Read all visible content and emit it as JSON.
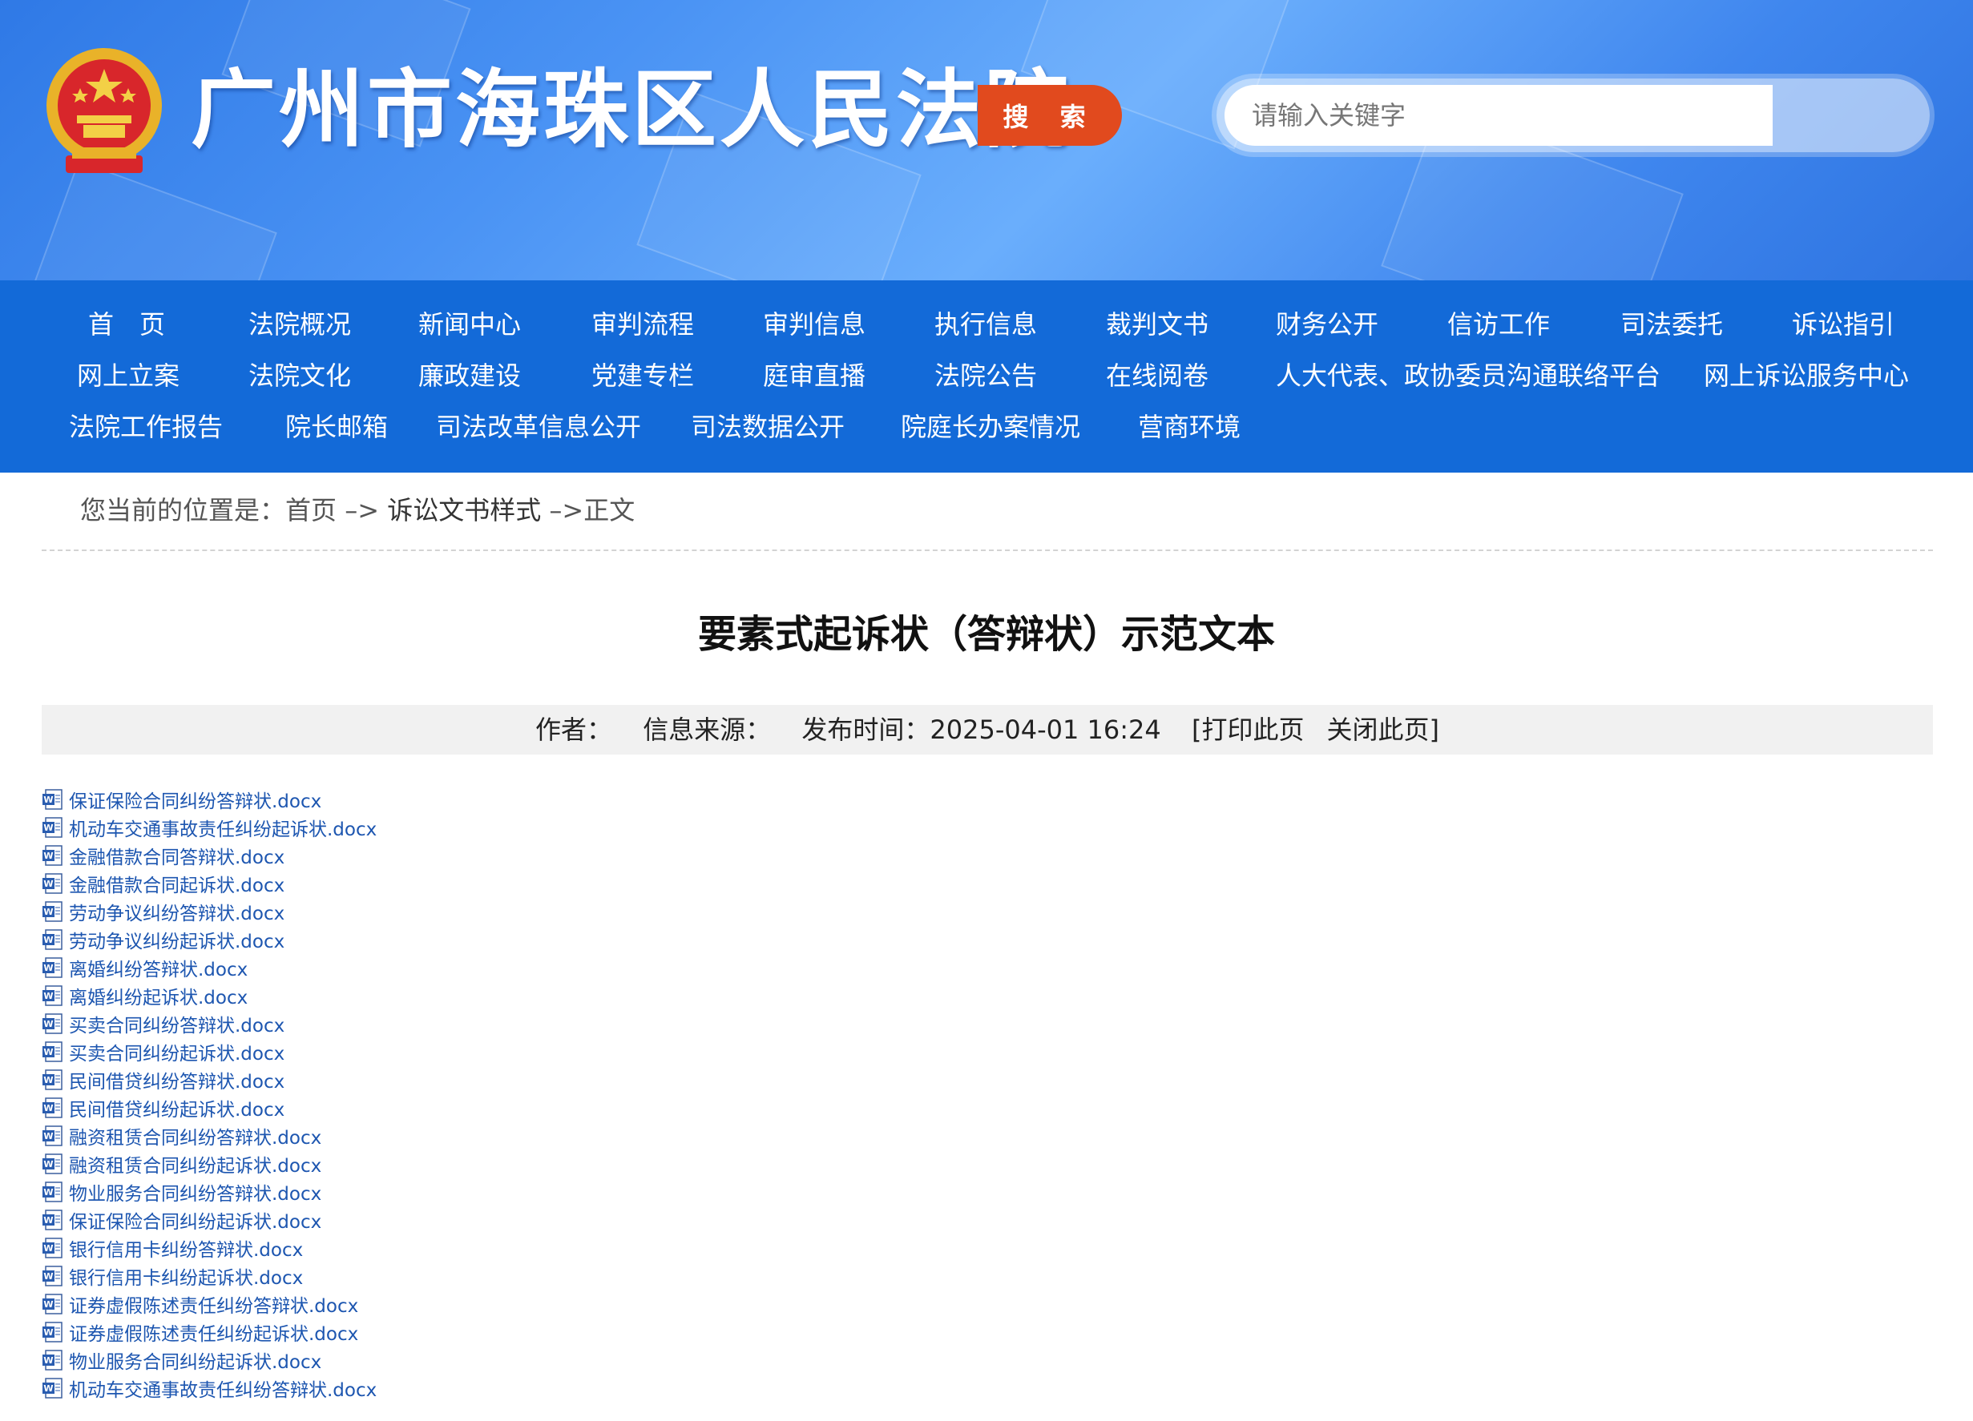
{
  "header": {
    "site_title": "广州市海珠区人民法院",
    "search": {
      "placeholder": "请输入关键字",
      "button_label": "搜 索"
    }
  },
  "nav": {
    "row1": [
      "首　页",
      "法院概况",
      "新闻中心",
      "审判流程",
      "审判信息",
      "执行信息",
      "裁判文书",
      "财务公开",
      "信访工作",
      "司法委托",
      "诉讼指引"
    ],
    "row2": [
      "网上立案",
      "法院文化",
      "廉政建设",
      "党建专栏",
      "庭审直播",
      "法院公告",
      "在线阅卷",
      "人大代表、政协委员沟通联络平台",
      "网上诉讼服务中心"
    ],
    "row3": [
      "法院工作报告",
      "院长邮箱",
      "司法改革信息公开",
      "司法数据公开",
      "院庭长办案情况",
      "营商环境"
    ]
  },
  "breadcrumb": {
    "prefix": "您当前的位置是：",
    "home": "首页",
    "sep1": " –> ",
    "section": "诉讼文书样式",
    "sep2": " –>",
    "current": "正文"
  },
  "article": {
    "title": "要素式起诉状（答辩状）示范文本",
    "meta": {
      "author": "作者：",
      "source": "信息来源：",
      "published": "发布时间：2025-04-01 16:24",
      "print": "[打印此页",
      "close": "关闭此页]"
    }
  },
  "files": [
    "保证保险合同纠纷答辩状.docx",
    "机动车交通事故责任纠纷起诉状.docx",
    "金融借款合同答辩状.docx",
    "金融借款合同起诉状.docx",
    "劳动争议纠纷答辩状.docx",
    "劳动争议纠纷起诉状.docx",
    "离婚纠纷答辩状.docx",
    "离婚纠纷起诉状.docx",
    "买卖合同纠纷答辩状.docx",
    "买卖合同纠纷起诉状.docx",
    "民间借贷纠纷答辩状.docx",
    "民间借贷纠纷起诉状.docx",
    "融资租赁合同纠纷答辩状.docx",
    "融资租赁合同纠纷起诉状.docx",
    "物业服务合同纠纷答辩状.docx",
    "保证保险合同纠纷起诉状.docx",
    "银行信用卡纠纷答辩状.docx",
    "银行信用卡纠纷起诉状.docx",
    "证券虚假陈述责任纠纷答辩状.docx",
    "证券虚假陈述责任纠纷起诉状.docx",
    "物业服务合同纠纷起诉状.docx",
    "机动车交通事故责任纠纷答辩状.docx"
  ],
  "colors": {
    "nav_bg": "#136ad8",
    "search_button": "#e14a1e",
    "link": "#1d56b0"
  }
}
